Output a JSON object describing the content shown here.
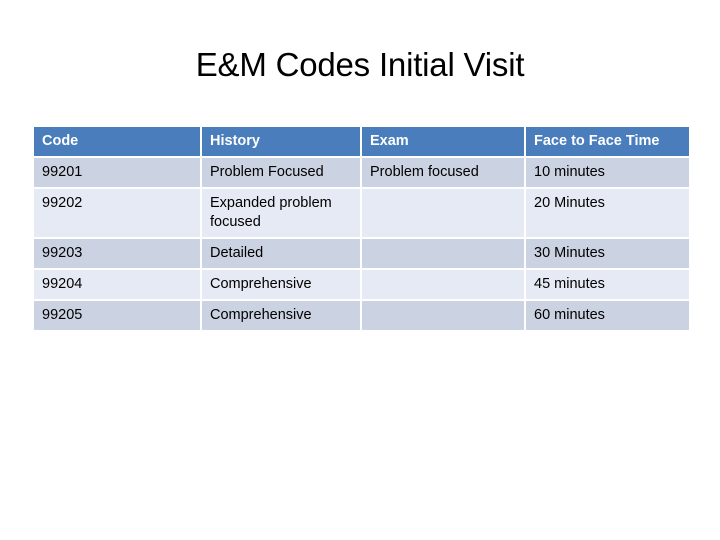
{
  "slide": {
    "title": "E&M Codes Initial Visit",
    "background_color": "#FFFFFF"
  },
  "table": {
    "header_color": "#4A7DBC",
    "header_text_color": "#FFFFFF",
    "row_color_dark": "#CBD3E2",
    "row_color_light": "#E6EAF4",
    "columns": [
      "Code",
      "History",
      "Exam",
      "Face to Face Time"
    ],
    "rows": [
      {
        "code": "99201",
        "history": "Problem Focused",
        "exam": "Problem focused",
        "time": "10 minutes"
      },
      {
        "code": "99202",
        "history": "Expanded problem focused",
        "exam": "",
        "time": "20 Minutes"
      },
      {
        "code": "99203",
        "history": "Detailed",
        "exam": "",
        "time": "30 Minutes"
      },
      {
        "code": "99204",
        "history": "Comprehensive",
        "exam": "",
        "time": "45 minutes"
      },
      {
        "code": "99205",
        "history": "Comprehensive",
        "exam": "",
        "time": "60 minutes"
      }
    ]
  }
}
